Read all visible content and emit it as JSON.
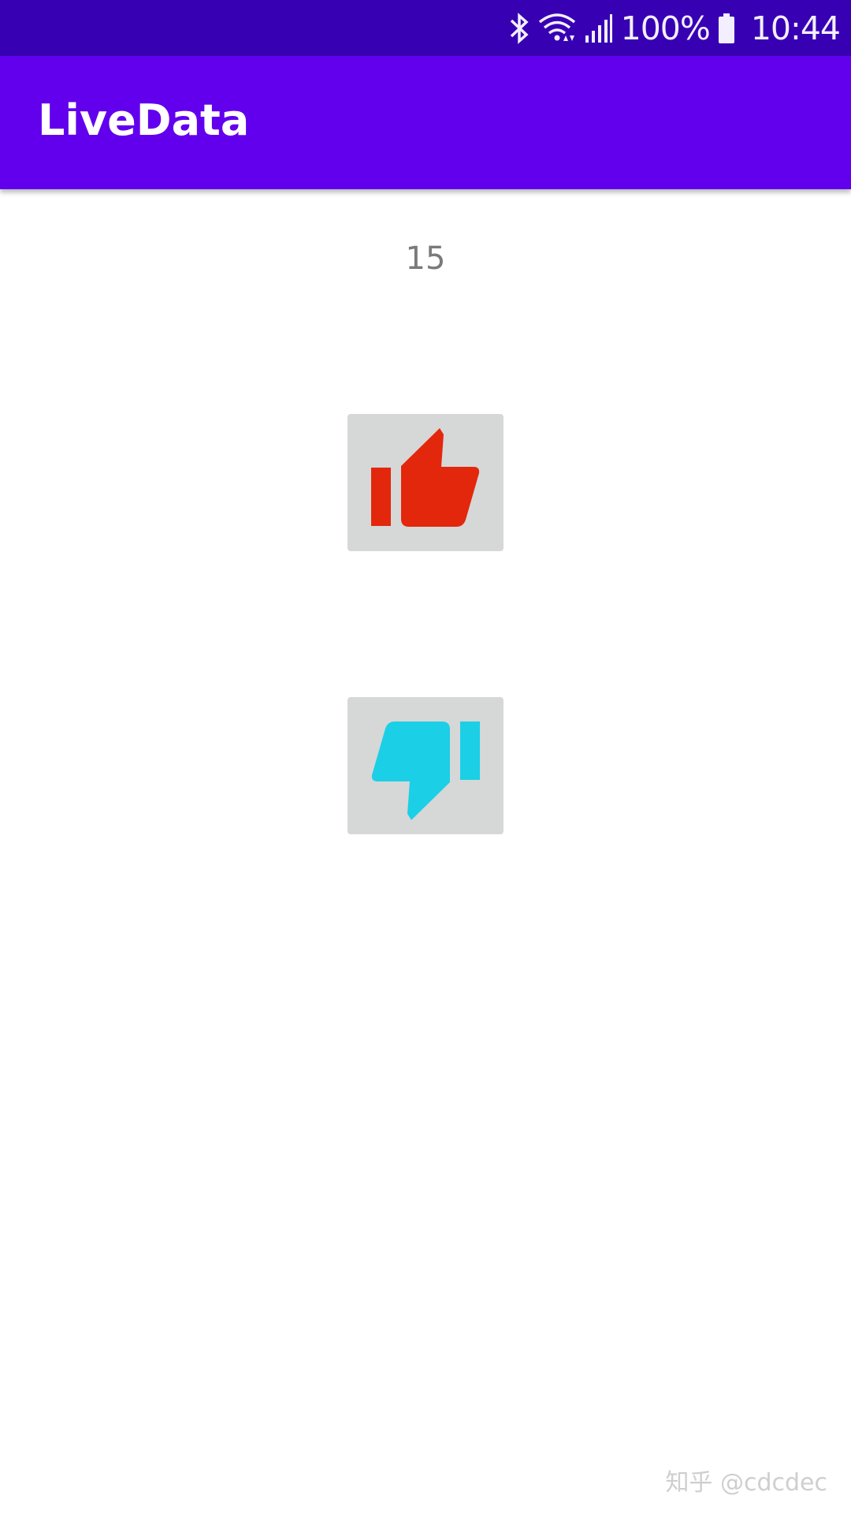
{
  "status_bar": {
    "battery_percent": "100%",
    "time": "10:44",
    "icons": [
      "bluetooth-icon",
      "wifi-icon",
      "signal-icon",
      "battery-icon"
    ]
  },
  "app_bar": {
    "title": "LiveData"
  },
  "main": {
    "counter_value": "15",
    "like_button": {
      "icon": "thumbs-up-icon",
      "color": "#e3270c"
    },
    "dislike_button": {
      "icon": "thumbs-down-icon",
      "color": "#1bcfe6"
    }
  },
  "watermark": {
    "text": "知乎 @cdcdec"
  },
  "colors": {
    "status_bar": "#3700b3",
    "app_bar": "#6200ee",
    "button_bg": "#d6d7d7"
  }
}
